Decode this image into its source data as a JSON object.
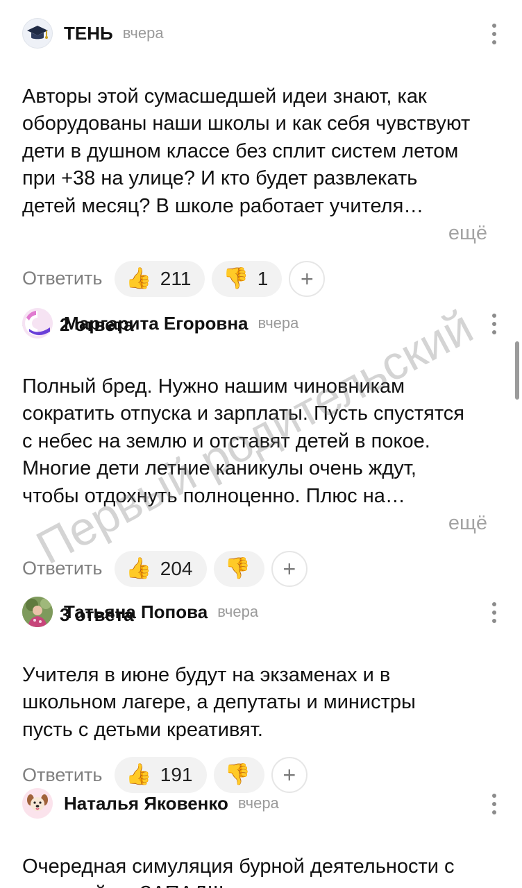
{
  "comments": [
    {
      "author": "ТЕНЬ",
      "time": "вчера",
      "avatar_icon": "graduation-cap-icon",
      "text": "Авторы этой сумасшедшей идеи знают, как\nоборудованы наши школы и как себя чувствуют\nдети в душном классе без сплит систем летом\nпри +38 на улице? И кто будет развлекать\nдетей месяц? В школе работает учителя…",
      "more": "ещё",
      "reply_label": "Ответить",
      "likes": "211",
      "dislikes": "1",
      "replies_label": "2 ответа"
    },
    {
      "author": "Маргарита Егоровна",
      "time": "вчера",
      "avatar_icon": "abstract-avatar-icon",
      "text": "Полный бред. Нужно нашим чиновникам\nсократить отпуска и зарплаты. Пусть спустятся\nс небес на землю и отставят детей в покое.\nМногие дети летние каникулы очень ждут,\nчтобы отдохнуть полноценно. Плюс на…",
      "more": "ещё",
      "reply_label": "Ответить",
      "likes": "204",
      "replies_label": "3 ответа"
    },
    {
      "author": "Татьяна Попова",
      "time": "вчера",
      "avatar_icon": "photo-avatar",
      "text": "Учителя в июне будут на экзаменах и в\nшкольном лагере, а депутаты и министры\nпусть с детьми креативят.",
      "reply_label": "Ответить",
      "likes": "191"
    },
    {
      "author": "Наталья Яковенко",
      "time": "вчера",
      "avatar_icon": "puppy-icon",
      "text": "Очередная симуляция бурной деятельности с\nоглядкой на ЗАПАД!!!"
    }
  ],
  "icons": {
    "like": "👍",
    "dislike": "👎",
    "plus": "+"
  },
  "watermark": "Первый родительский",
  "colors": {
    "muted": "#7f7f7f",
    "pill_bg": "#f2f2f2",
    "accent_avatar": "#7b3fe4"
  }
}
